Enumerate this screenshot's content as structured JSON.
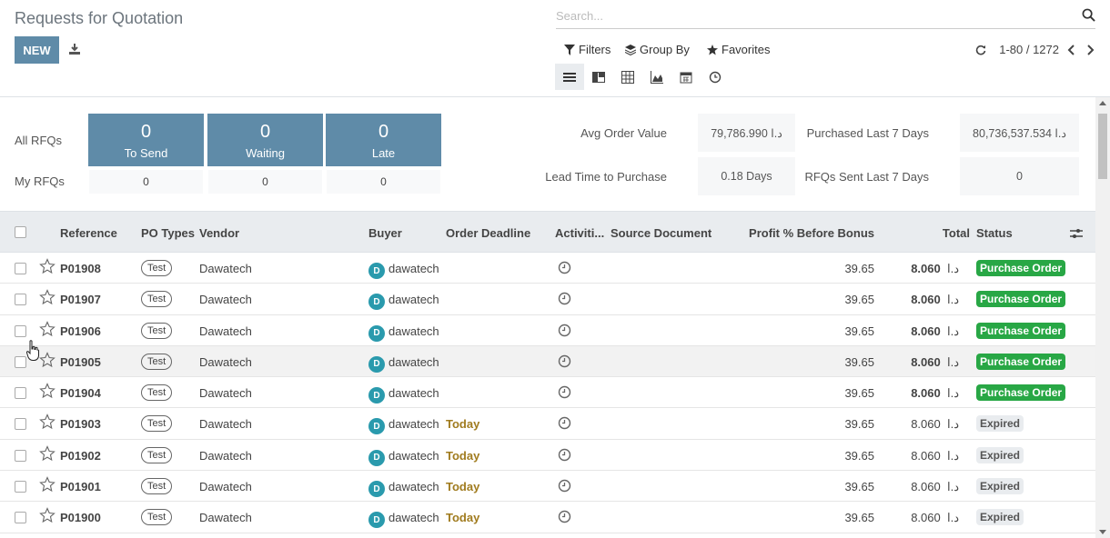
{
  "header": {
    "title": "Requests for Quotation",
    "new_label": "NEW",
    "search_placeholder": "Search...",
    "filters_label": "Filters",
    "groupby_label": "Group By",
    "favorites_label": "Favorites",
    "pager_value": "1-80 / 1272"
  },
  "dashboard": {
    "all_rfqs_label": "All RFQs",
    "my_rfqs_label": "My RFQs",
    "tiles": [
      {
        "count": "0",
        "label": "To Send",
        "mine": "0"
      },
      {
        "count": "0",
        "label": "Waiting",
        "mine": "0"
      },
      {
        "count": "0",
        "label": "Late",
        "mine": "0"
      }
    ],
    "kpis": {
      "avg_order_label": "Avg Order Value",
      "avg_order_value": "79,786.990 د.ا",
      "purchased_label": "Purchased Last 7 Days",
      "purchased_value": "80,736,537.534 د.ا",
      "lead_time_label": "Lead Time to Purchase",
      "lead_time_value": "0.18 Days",
      "rfqs_sent_label": "RFQs Sent Last 7 Days",
      "rfqs_sent_value": "0"
    }
  },
  "table": {
    "columns": {
      "reference": "Reference",
      "po_types": "PO Types",
      "vendor": "Vendor",
      "buyer": "Buyer",
      "deadline": "Order Deadline",
      "activities": "Activiti...",
      "source": "Source Document",
      "profit": "Profit % Before Bonus",
      "total": "Total",
      "status": "Status"
    },
    "rows": [
      {
        "ref": "P01908",
        "tag": "Test",
        "vendor": "Dawatech",
        "avatar": "D",
        "buyer": "dawatech",
        "deadline": "",
        "profit": "39.65",
        "total": "8.060",
        "currency": "د.ا",
        "status": "Purchase Order",
        "kind": "po"
      },
      {
        "ref": "P01907",
        "tag": "Test",
        "vendor": "Dawatech",
        "avatar": "D",
        "buyer": "dawatech",
        "deadline": "",
        "profit": "39.65",
        "total": "8.060",
        "currency": "د.ا",
        "status": "Purchase Order",
        "kind": "po"
      },
      {
        "ref": "P01906",
        "tag": "Test",
        "vendor": "Dawatech",
        "avatar": "D",
        "buyer": "dawatech",
        "deadline": "",
        "profit": "39.65",
        "total": "8.060",
        "currency": "د.ا",
        "status": "Purchase Order",
        "kind": "po"
      },
      {
        "ref": "P01905",
        "tag": "Test",
        "vendor": "Dawatech",
        "avatar": "D",
        "buyer": "dawatech",
        "deadline": "",
        "profit": "39.65",
        "total": "8.060",
        "currency": "د.ا",
        "status": "Purchase Order",
        "kind": "po"
      },
      {
        "ref": "P01904",
        "tag": "Test",
        "vendor": "Dawatech",
        "avatar": "D",
        "buyer": "dawatech",
        "deadline": "",
        "profit": "39.65",
        "total": "8.060",
        "currency": "د.ا",
        "status": "Purchase Order",
        "kind": "po"
      },
      {
        "ref": "P01903",
        "tag": "Test",
        "vendor": "Dawatech",
        "avatar": "D",
        "buyer": "dawatech",
        "deadline": "Today",
        "profit": "39.65",
        "total": "8.060",
        "currency": "د.ا",
        "status": "Expired",
        "kind": "ex"
      },
      {
        "ref": "P01902",
        "tag": "Test",
        "vendor": "Dawatech",
        "avatar": "D",
        "buyer": "dawatech",
        "deadline": "Today",
        "profit": "39.65",
        "total": "8.060",
        "currency": "د.ا",
        "status": "Expired",
        "kind": "ex"
      },
      {
        "ref": "P01901",
        "tag": "Test",
        "vendor": "Dawatech",
        "avatar": "D",
        "buyer": "dawatech",
        "deadline": "Today",
        "profit": "39.65",
        "total": "8.060",
        "currency": "د.ا",
        "status": "Expired",
        "kind": "ex"
      },
      {
        "ref": "P01900",
        "tag": "Test",
        "vendor": "Dawatech",
        "avatar": "D",
        "buyer": "dawatech",
        "deadline": "Today",
        "profit": "39.65",
        "total": "8.060",
        "currency": "د.ا",
        "status": "Expired",
        "kind": "ex"
      }
    ]
  },
  "colors": {
    "primary": "#5f8ba8",
    "success": "#28a745",
    "avatar": "#2a9aad",
    "today": "#a07b1e"
  }
}
